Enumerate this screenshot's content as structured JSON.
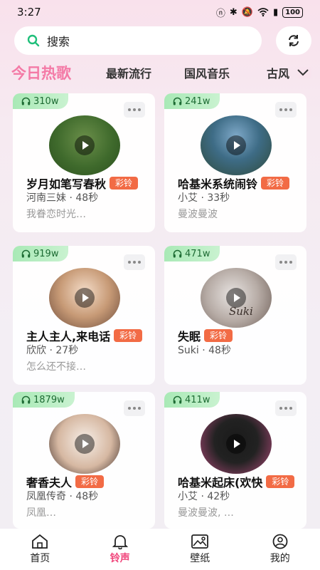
{
  "status_bar": {
    "time": "3:27",
    "battery": "100"
  },
  "search": {
    "placeholder": "搜索"
  },
  "tabs": [
    {
      "label": "今日热歌",
      "active": true
    },
    {
      "label": "最新流行",
      "active": false
    },
    {
      "label": "国风音乐",
      "active": false
    },
    {
      "label": "古风",
      "active": false
    }
  ],
  "cards": [
    {
      "plays": "310w",
      "title": "岁月如笔写春秋",
      "tag": "彩铃",
      "artist": "河南三妹",
      "duration": "48秒",
      "meta": "河南三妹 · 48秒",
      "desc": "我眷恋时光…"
    },
    {
      "plays": "241w",
      "title": "哈基米系统闹铃",
      "tag": "彩铃",
      "artist": "小艾",
      "duration": "33秒",
      "meta": "小艾 · 33秒",
      "desc": "曼波曼波"
    },
    {
      "plays": "919w",
      "title": "主人主人,来电话",
      "tag": "彩铃",
      "artist": "欣欣",
      "duration": "27秒",
      "meta": "欣欣 · 27秒",
      "desc": "怎么还不接…"
    },
    {
      "plays": "471w",
      "title": "失眠",
      "tag": "彩铃",
      "artist": "Suki",
      "duration": "48秒",
      "meta": "Suki · 48秒",
      "desc": ""
    },
    {
      "plays": "1879w",
      "title": "奢香夫人",
      "tag": "彩铃",
      "artist": "凤凰传奇",
      "duration": "48秒",
      "meta": "凤凰传奇 · 48秒",
      "desc": "凤凰…"
    },
    {
      "plays": "411w",
      "title": "哈基米起床(欢快",
      "tag": "彩铃",
      "artist": "小艾",
      "duration": "42秒",
      "meta": "小艾 · 42秒",
      "desc": "曼波曼波, …"
    }
  ],
  "cover_texts": {
    "suki": "Suki"
  },
  "bottom_nav": [
    {
      "label": "首页",
      "icon": "home-icon",
      "active": false
    },
    {
      "label": "铃声",
      "icon": "bell-icon",
      "active": true
    },
    {
      "label": "壁纸",
      "icon": "image-icon",
      "active": false
    },
    {
      "label": "我的",
      "icon": "user-icon",
      "active": false
    }
  ],
  "colors": {
    "accent": "#f0447a",
    "tab_active": "#f47aa6",
    "tag": "#f26b45",
    "plays_badge": "#a9e9b6"
  }
}
